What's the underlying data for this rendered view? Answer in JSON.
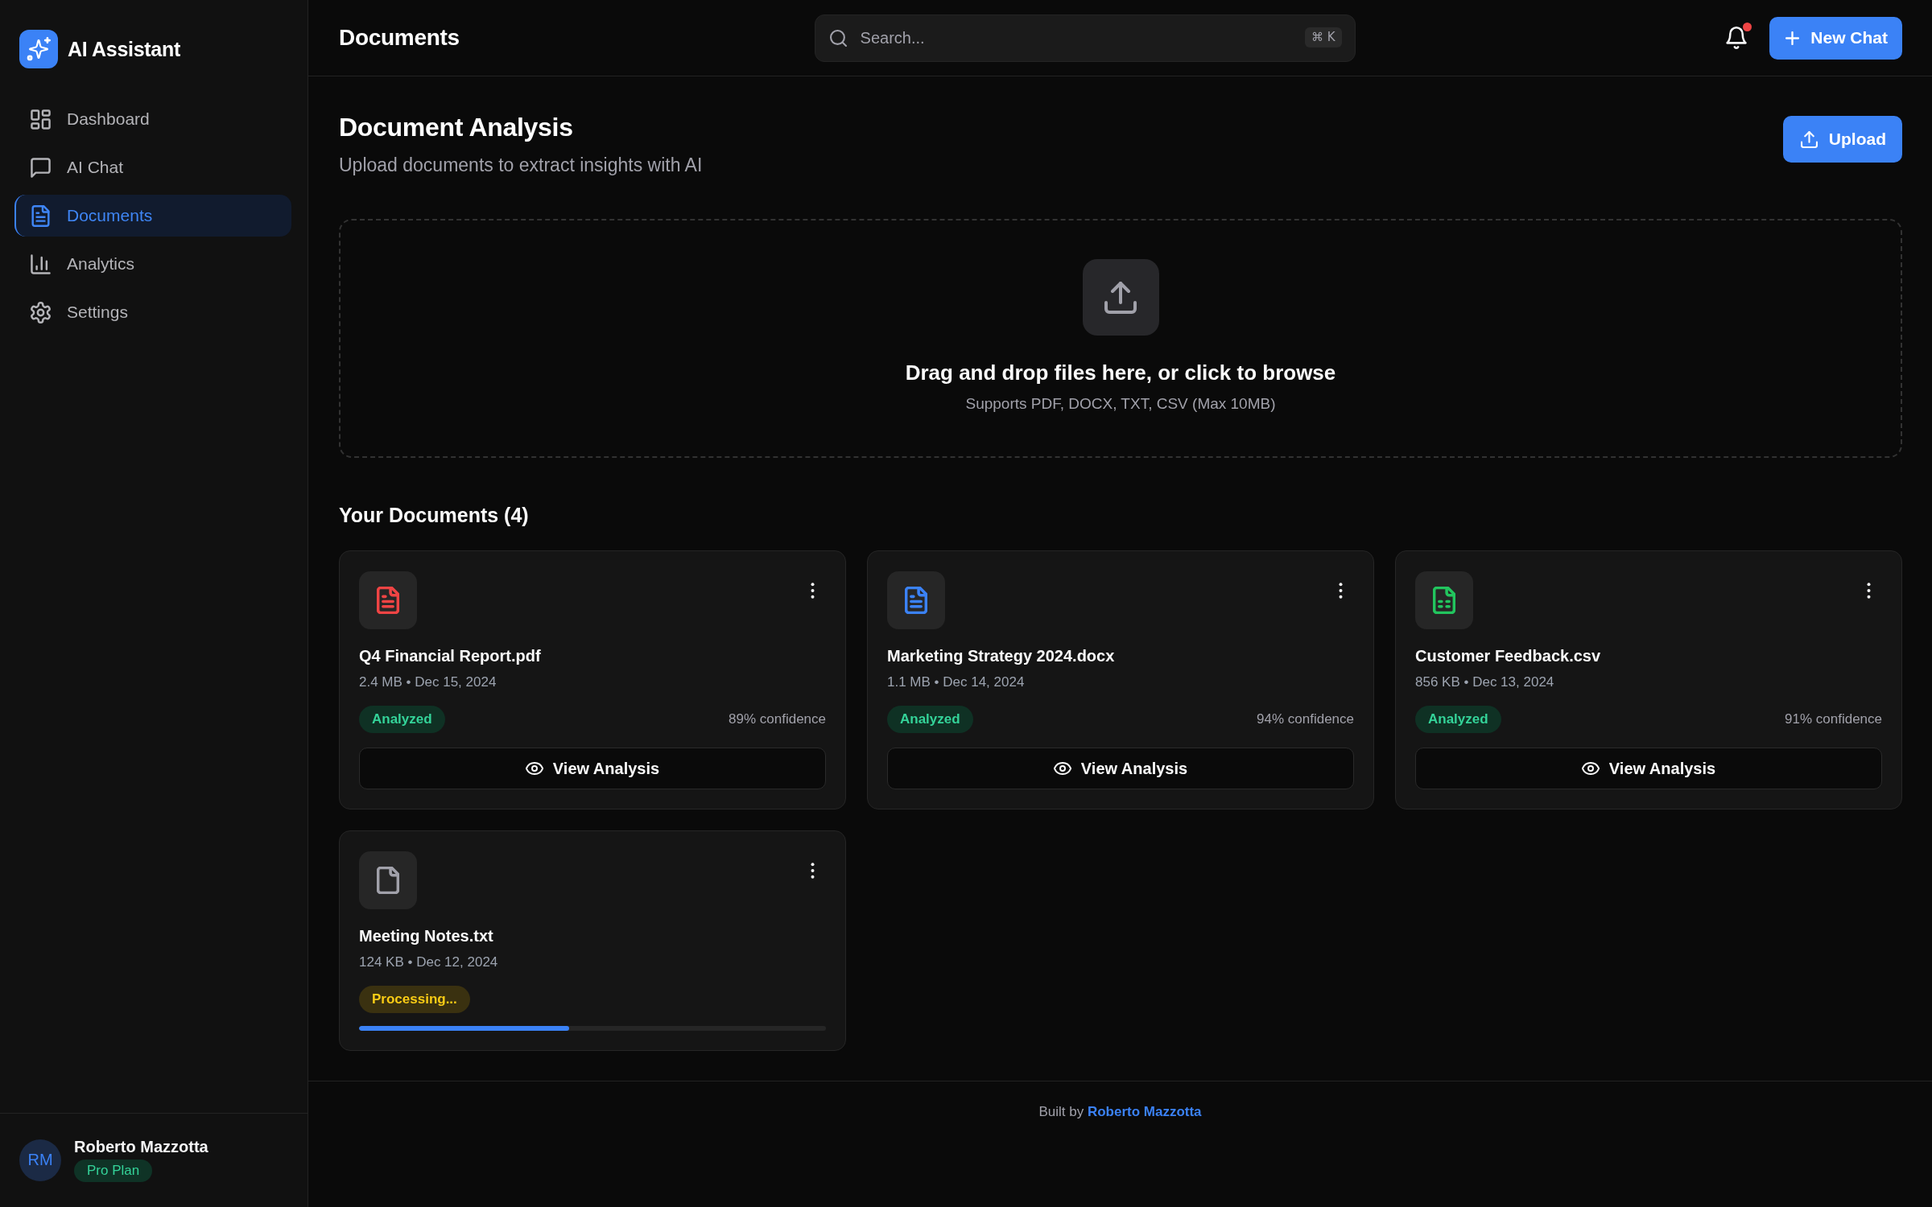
{
  "sidebar": {
    "brand": "AI Assistant",
    "nav": [
      {
        "label": "Dashboard",
        "kind": "dashboard",
        "selected": false
      },
      {
        "label": "AI Chat",
        "kind": "chat",
        "selected": false
      },
      {
        "label": "Documents",
        "kind": "documents",
        "selected": true
      },
      {
        "label": "Analytics",
        "kind": "analytics",
        "selected": false
      },
      {
        "label": "Settings",
        "kind": "settings",
        "selected": false
      }
    ],
    "user": {
      "initials": "RM",
      "name": "Roberto Mazzotta",
      "plan": "Pro Plan"
    }
  },
  "header": {
    "title": "Documents",
    "search": {
      "placeholder": "Search...",
      "shortcut": "⌘ K"
    },
    "notifications": {
      "unread": true
    },
    "new_chat_button": "New Chat"
  },
  "page": {
    "title": "Document Analysis",
    "subtitle": "Upload documents to extract insights with AI",
    "upload_button": "Upload"
  },
  "dropzone": {
    "headline": "Drag and drop files here, or click to browse",
    "hint": "Supports PDF, DOCX, TXT, CSV (Max 10MB)"
  },
  "documents": {
    "heading": "Your Documents (4)",
    "items": [
      {
        "name": "Q4 Financial Report.pdf",
        "meta": "2.4 MB • Dec 15, 2024",
        "kind": "pdf",
        "color": "#ef4444",
        "status": {
          "kind": "analyzed",
          "label": "Analyzed"
        },
        "confidence": "89% confidence",
        "action": "View Analysis"
      },
      {
        "name": "Marketing Strategy 2024.docx",
        "meta": "1.1 MB • Dec 14, 2024",
        "kind": "docx",
        "color": "#3b82f6",
        "status": {
          "kind": "analyzed",
          "label": "Analyzed"
        },
        "confidence": "94% confidence",
        "action": "View Analysis"
      },
      {
        "name": "Customer Feedback.csv",
        "meta": "856 KB • Dec 13, 2024",
        "kind": "csv",
        "color": "#22c55e",
        "status": {
          "kind": "analyzed",
          "label": "Analyzed"
        },
        "confidence": "91% confidence",
        "action": "View Analysis"
      },
      {
        "name": "Meeting Notes.txt",
        "meta": "124 KB • Dec 12, 2024",
        "kind": "txt",
        "color": "#a1a1aa",
        "status": {
          "kind": "processing",
          "label": "Processing..."
        },
        "level": 0.45
      }
    ]
  },
  "footer": {
    "prefix": "Built by",
    "author": "Roberto Mazzotta"
  }
}
